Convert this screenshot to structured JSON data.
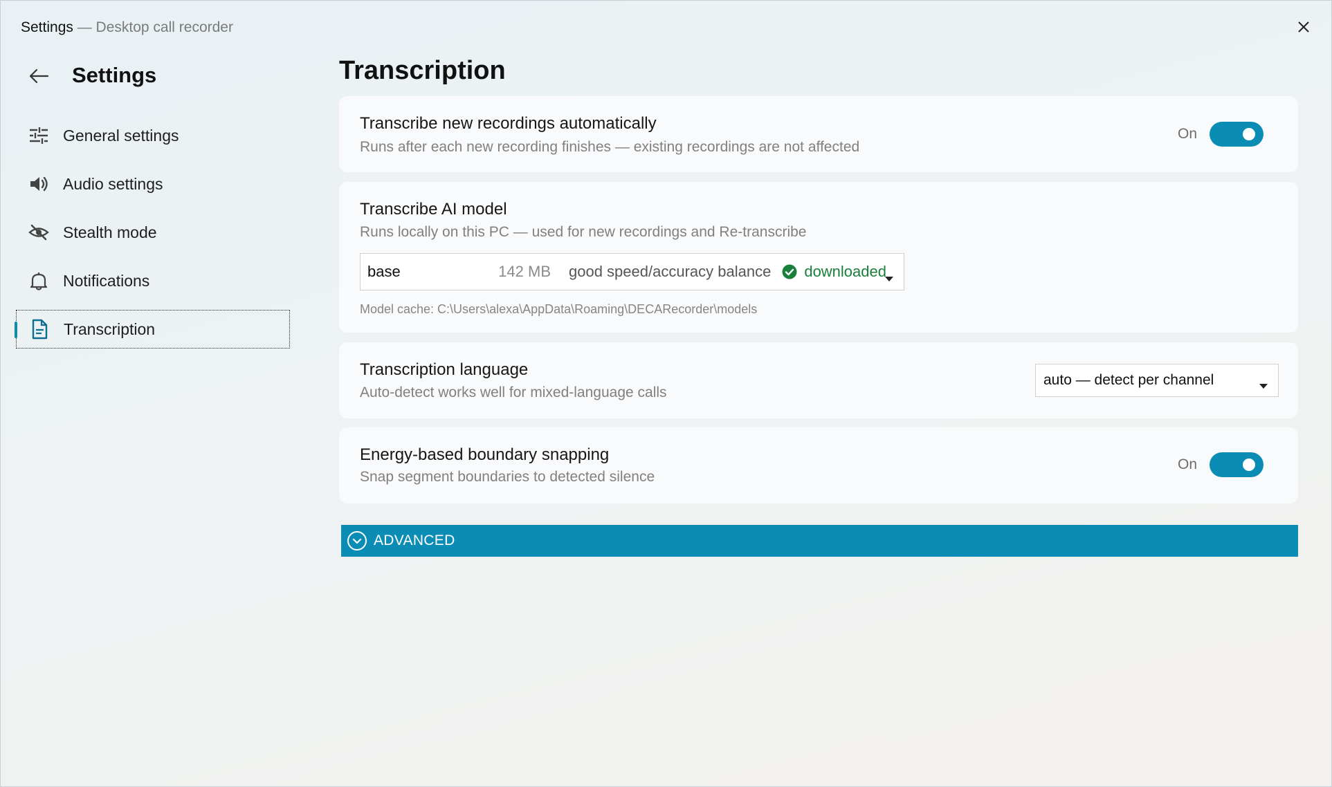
{
  "titlebar": {
    "app": "Settings",
    "subtitle": " — Desktop call recorder"
  },
  "sidebar": {
    "title": "Settings",
    "items": [
      {
        "label": "General settings",
        "icon": "sliders-icon"
      },
      {
        "label": "Audio settings",
        "icon": "speaker-icon"
      },
      {
        "label": "Stealth mode",
        "icon": "eye-off-icon"
      },
      {
        "label": "Notifications",
        "icon": "bell-icon"
      },
      {
        "label": "Transcription",
        "icon": "document-icon",
        "active": true
      }
    ]
  },
  "main": {
    "title": "Transcription",
    "auto_transcribe": {
      "title": "Transcribe new recordings automatically",
      "subtitle": "Runs after each new recording finishes — existing recordings are not affected",
      "state": "On"
    },
    "model": {
      "title": "Transcribe AI model",
      "subtitle": "Runs locally on this PC — used for new recordings and Re-transcribe",
      "selected_name": "base",
      "selected_size": "142 MB",
      "selected_desc": "good speed/accuracy balance",
      "selected_status": "downloaded",
      "cache_path": "Model cache: C:\\Users\\alexa\\AppData\\Roaming\\DECARecorder\\models"
    },
    "language": {
      "title": "Transcription language",
      "subtitle": "Auto-detect works well for mixed-language calls",
      "selected": "auto — detect per channel"
    },
    "boundary": {
      "title": "Energy-based boundary snapping",
      "subtitle": "Snap segment boundaries to detected silence",
      "state": "On"
    },
    "advanced_label": "ADVANCED"
  },
  "colors": {
    "accent": "#0b8cb4",
    "success": "#1a7f3a"
  }
}
